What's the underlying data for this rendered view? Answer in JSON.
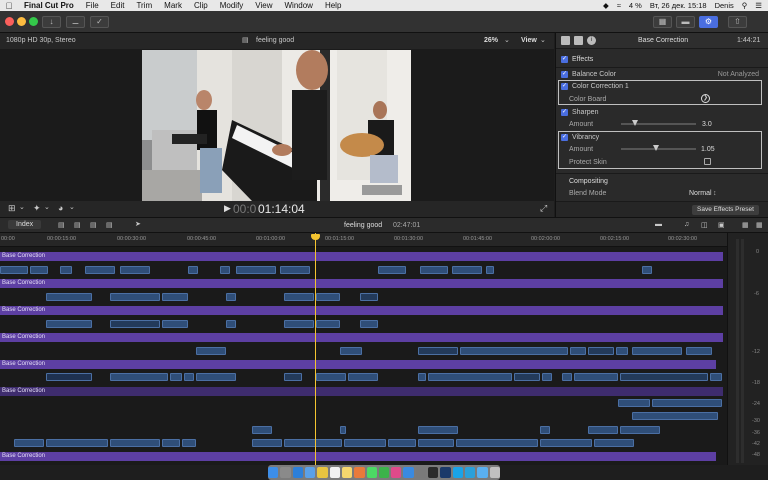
{
  "menubar": {
    "app": "Final Cut Pro",
    "items": [
      "File",
      "Edit",
      "Trim",
      "Mark",
      "Clip",
      "Modify",
      "View",
      "Window",
      "Help"
    ],
    "battery": "4 %",
    "datetime": "Вт, 26 дек. 15:18",
    "user": "Denis"
  },
  "viewer": {
    "format": "1080p HD 30p, Stereo",
    "clip_title": "feeling good",
    "zoom": "26%",
    "view_label": "View",
    "timecode_dim": "00:0",
    "timecode": "01:14:04"
  },
  "inspector": {
    "title": "Base Correction",
    "duration": "1:44:21",
    "effects_label": "Effects",
    "balance_color": "Balance Color",
    "balance_status": "Not Analyzed",
    "color_correction": "Color Correction 1",
    "color_board": "Color Board",
    "sharpen": "Sharpen",
    "sharpen_amount_label": "Amount",
    "sharpen_amount": "3.0",
    "vibrancy": "Vibrancy",
    "vibrancy_amount_label": "Amount",
    "vibrancy_amount": "1.05",
    "protect_skin": "Protect Skin",
    "compositing": "Compositing",
    "blend_mode_label": "Blend Mode",
    "blend_mode": "Normal",
    "save_preset": "Save Effects Preset"
  },
  "timeline": {
    "index_label": "Index",
    "project": "feeling good",
    "duration": "02:47:01",
    "ruler": [
      "00:00",
      "00:00:15:00",
      "00:00:30:00",
      "00:00:45:00",
      "00:01:00:00",
      "00:01:15:00",
      "00:01:30:00",
      "00:01:45:00",
      "00:02:00:00",
      "00:02:15:00",
      "00:02:30:00"
    ],
    "adjustment_label": "Base Correction",
    "meter_labels": [
      "0",
      "-6",
      "-12",
      "-18",
      "-24",
      "-30",
      "-36",
      "-42",
      "-48"
    ]
  },
  "colors": {
    "accent": "#4a6ee0",
    "adjustment": "#5d3fa3",
    "clip": "#2f4e78",
    "playhead": "#f4c430"
  }
}
